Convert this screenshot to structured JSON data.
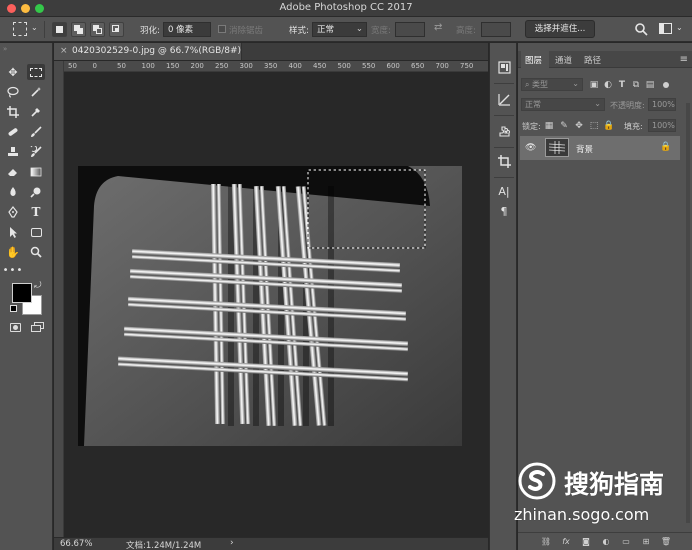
{
  "window": {
    "title": "Adobe Photoshop CC 2017"
  },
  "options_bar": {
    "feather_label": "羽化:",
    "feather_value": "0 像素",
    "anti_alias_label": "消除锯齿",
    "style_label": "样式:",
    "style_value": "正常",
    "width_label": "宽度:",
    "height_label": "高度:",
    "select_and_mask_label": "选择并遮住..."
  },
  "document": {
    "tab_title": "0420302529-0.jpg @ 66.7%(RGB/8#)",
    "ruler_labels": [
      "50",
      "0",
      "50",
      "100",
      "150",
      "200",
      "250",
      "300",
      "350",
      "400",
      "450",
      "500",
      "550",
      "600",
      "650",
      "700",
      "750"
    ],
    "zoom": "66.67%",
    "doc_size": "文档:1.24M/1.24M"
  },
  "layers_panel": {
    "tabs": [
      "图层",
      "通道",
      "路径"
    ],
    "active_tab": 0,
    "filter_placeholder": "类型",
    "blend_mode": "正常",
    "opacity_label": "不透明度:",
    "opacity_value": "100%",
    "lock_label": "锁定:",
    "fill_label": "填充:",
    "fill_value": "100%",
    "layers": [
      {
        "name": "背景",
        "visible": true,
        "locked": true
      }
    ]
  },
  "watermark": {
    "brand": "搜狗指南",
    "url": "zhinan.sogo.com"
  },
  "colors": {
    "foreground": "#000000",
    "background": "#ffffff",
    "panel": "#535353",
    "canvas_bg": "#282828"
  }
}
